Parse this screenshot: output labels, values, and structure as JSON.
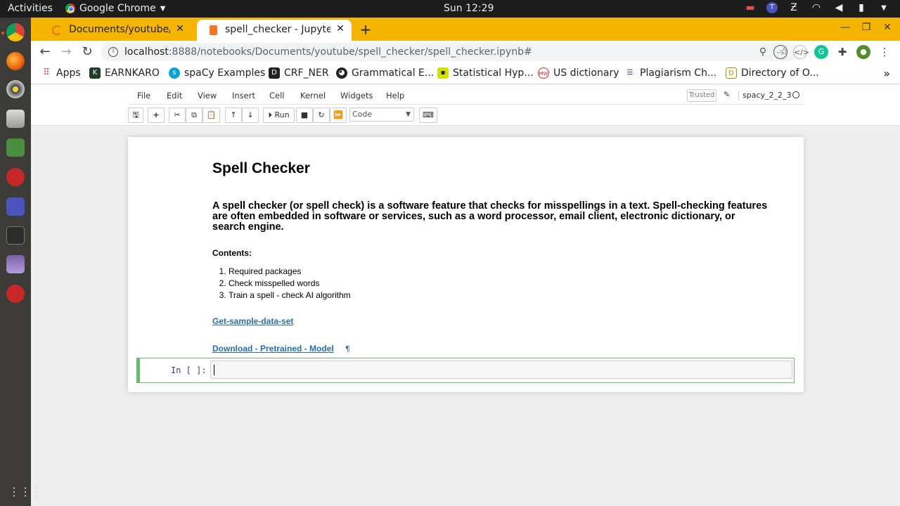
{
  "system_bar": {
    "activities": "Activities",
    "app_name": "Google Chrome",
    "clock": "Sun 12:29"
  },
  "browser": {
    "tabs": [
      {
        "title": "Documents/youtube/spell",
        "active": false
      },
      {
        "title": "spell_checker - Jupyter Nc",
        "active": true
      }
    ],
    "url_host": "localhost",
    "url_path": ":8888/notebooks/Documents/youtube/spell_checker/spell_checker.ipynb#",
    "bookmarks": [
      {
        "label": "Apps",
        "icon": "apps-grid-icon"
      },
      {
        "label": "EARNKARO",
        "icon": "earnkaro-icon"
      },
      {
        "label": "spaCy Examples",
        "icon": "spacy-icon"
      },
      {
        "label": "CRF_NER",
        "icon": "d-icon"
      },
      {
        "label": "Grammatical E...",
        "icon": "github-icon"
      },
      {
        "label": "Statistical Hyp...",
        "icon": "stat-icon"
      },
      {
        "label": "US dictionary",
        "icon": "dict-icon"
      },
      {
        "label": "Plagiarism Ch...",
        "icon": "plagiarism-icon"
      },
      {
        "label": "Directory of O...",
        "icon": "directory-icon"
      }
    ]
  },
  "jupyter": {
    "menu": [
      "File",
      "Edit",
      "View",
      "Insert",
      "Cell",
      "Kernel",
      "Widgets",
      "Help"
    ],
    "trusted": "Trusted",
    "kernel_name": "spacy_2_2_3",
    "run_label": "Run",
    "cell_type": "Code"
  },
  "notebook": {
    "title": "Spell Checker",
    "intro": "A spell checker (or spell check) is a software feature that checks for misspellings in a text. Spell-checking features are often embedded in software or services, such as a word processor, email client, electronic dictionary, or search engine.",
    "contents_heading": "Contents:",
    "contents": [
      "Required packages",
      "Check misspelled words",
      "Train a spell - check AI algorithm"
    ],
    "link_dataset": "Get-sample-data-set",
    "link_model": "Download - Pretrained - Model",
    "pilcrow": "¶",
    "prompt": "In [ ]:"
  },
  "colors": {
    "tabstrip": "#f5b400",
    "dock": "#3c3b37",
    "selected_cell_border": "#66bb6a",
    "link": "#296eaa",
    "prompt": "#303f9f"
  }
}
